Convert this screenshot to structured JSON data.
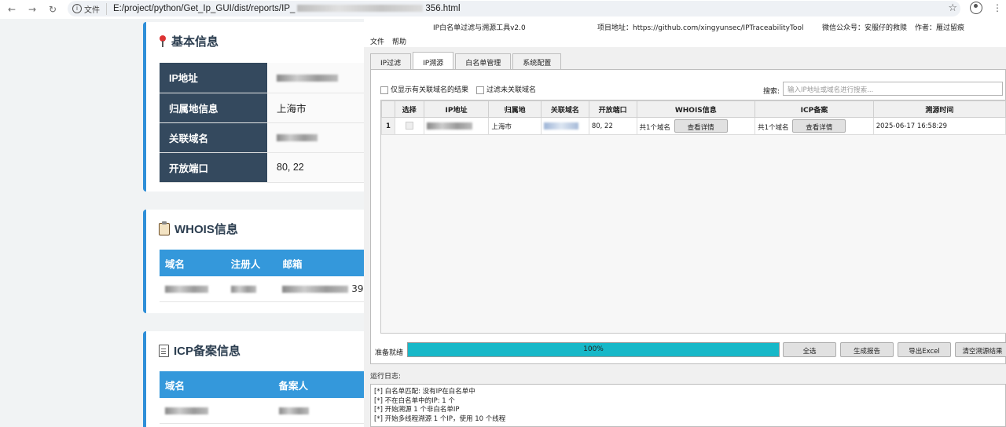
{
  "browser": {
    "back_icon": "back-arrow-icon",
    "forward_icon": "forward-arrow-icon",
    "reload_icon": "reload-icon",
    "secure_label": "文件",
    "url_prefix": "E:/project/python/Get_Ip_GUI/dist/reports/IP_",
    "url_suffix": "356.html"
  },
  "report": {
    "basic_title": "基本信息",
    "basic_rows": [
      {
        "key": "IP地址",
        "value": ""
      },
      {
        "key": "归属地信息",
        "value": "上海市"
      },
      {
        "key": "关联域名",
        "value": ""
      },
      {
        "key": "开放端口",
        "value": "80, 22"
      }
    ],
    "whois_title": "WHOIS信息",
    "whois_headers": [
      "域名",
      "注册人",
      "邮箱"
    ],
    "whois_row_tail": "39.",
    "icp_title": "ICP备案信息",
    "icp_headers": [
      "域名",
      "备案人"
    ]
  },
  "app": {
    "title": "IP白名单过滤与溯源工具v2.0",
    "project": "项目地址：https://github.com/xingyunsec/IPTraceabilityTool",
    "wechat": "微信公众号：安服仔的救赎",
    "author": "作者：雁过留痕",
    "menu": [
      "文件",
      "帮助"
    ],
    "tabs": [
      "IP过滤",
      "IP溯源",
      "白名单管理",
      "系统配置"
    ],
    "active_tab": 1,
    "filter_show_related": "仅显示有关联域名的结果",
    "filter_no_related": "过滤未关联域名",
    "search_label": "搜索:",
    "search_placeholder": "输入IP地址或域名进行搜索...",
    "columns": [
      "选择",
      "IP地址",
      "归属地",
      "关联域名",
      "开放端口",
      "WHOIS信息",
      "ICP备案",
      "溯源时间"
    ],
    "row": {
      "num": "1",
      "location": "上海市",
      "ports": "80, 22",
      "whois_count": "共1个域名",
      "whois_btn": "查看详情",
      "icp_count": "共1个域名",
      "icp_btn": "查看详情",
      "time": "2025-06-17 16:58:29"
    },
    "status": "准备就绪",
    "progress": 1.0,
    "progress_text": "100%",
    "buttons": [
      "全选",
      "生成报告",
      "导出Excel",
      "清空溯源结果"
    ],
    "log_label": "运行日志:",
    "log_lines": [
      "[*] 白名单匹配: 没有IP在白名单中",
      "[*] 不在白名单中的IP: 1 个",
      "[*] 开始溯源 1 个非白名单IP",
      "[*] 开始多线程溯源 1 个IP，使用 10 个线程"
    ],
    "accent_color": "#17b8c8"
  }
}
